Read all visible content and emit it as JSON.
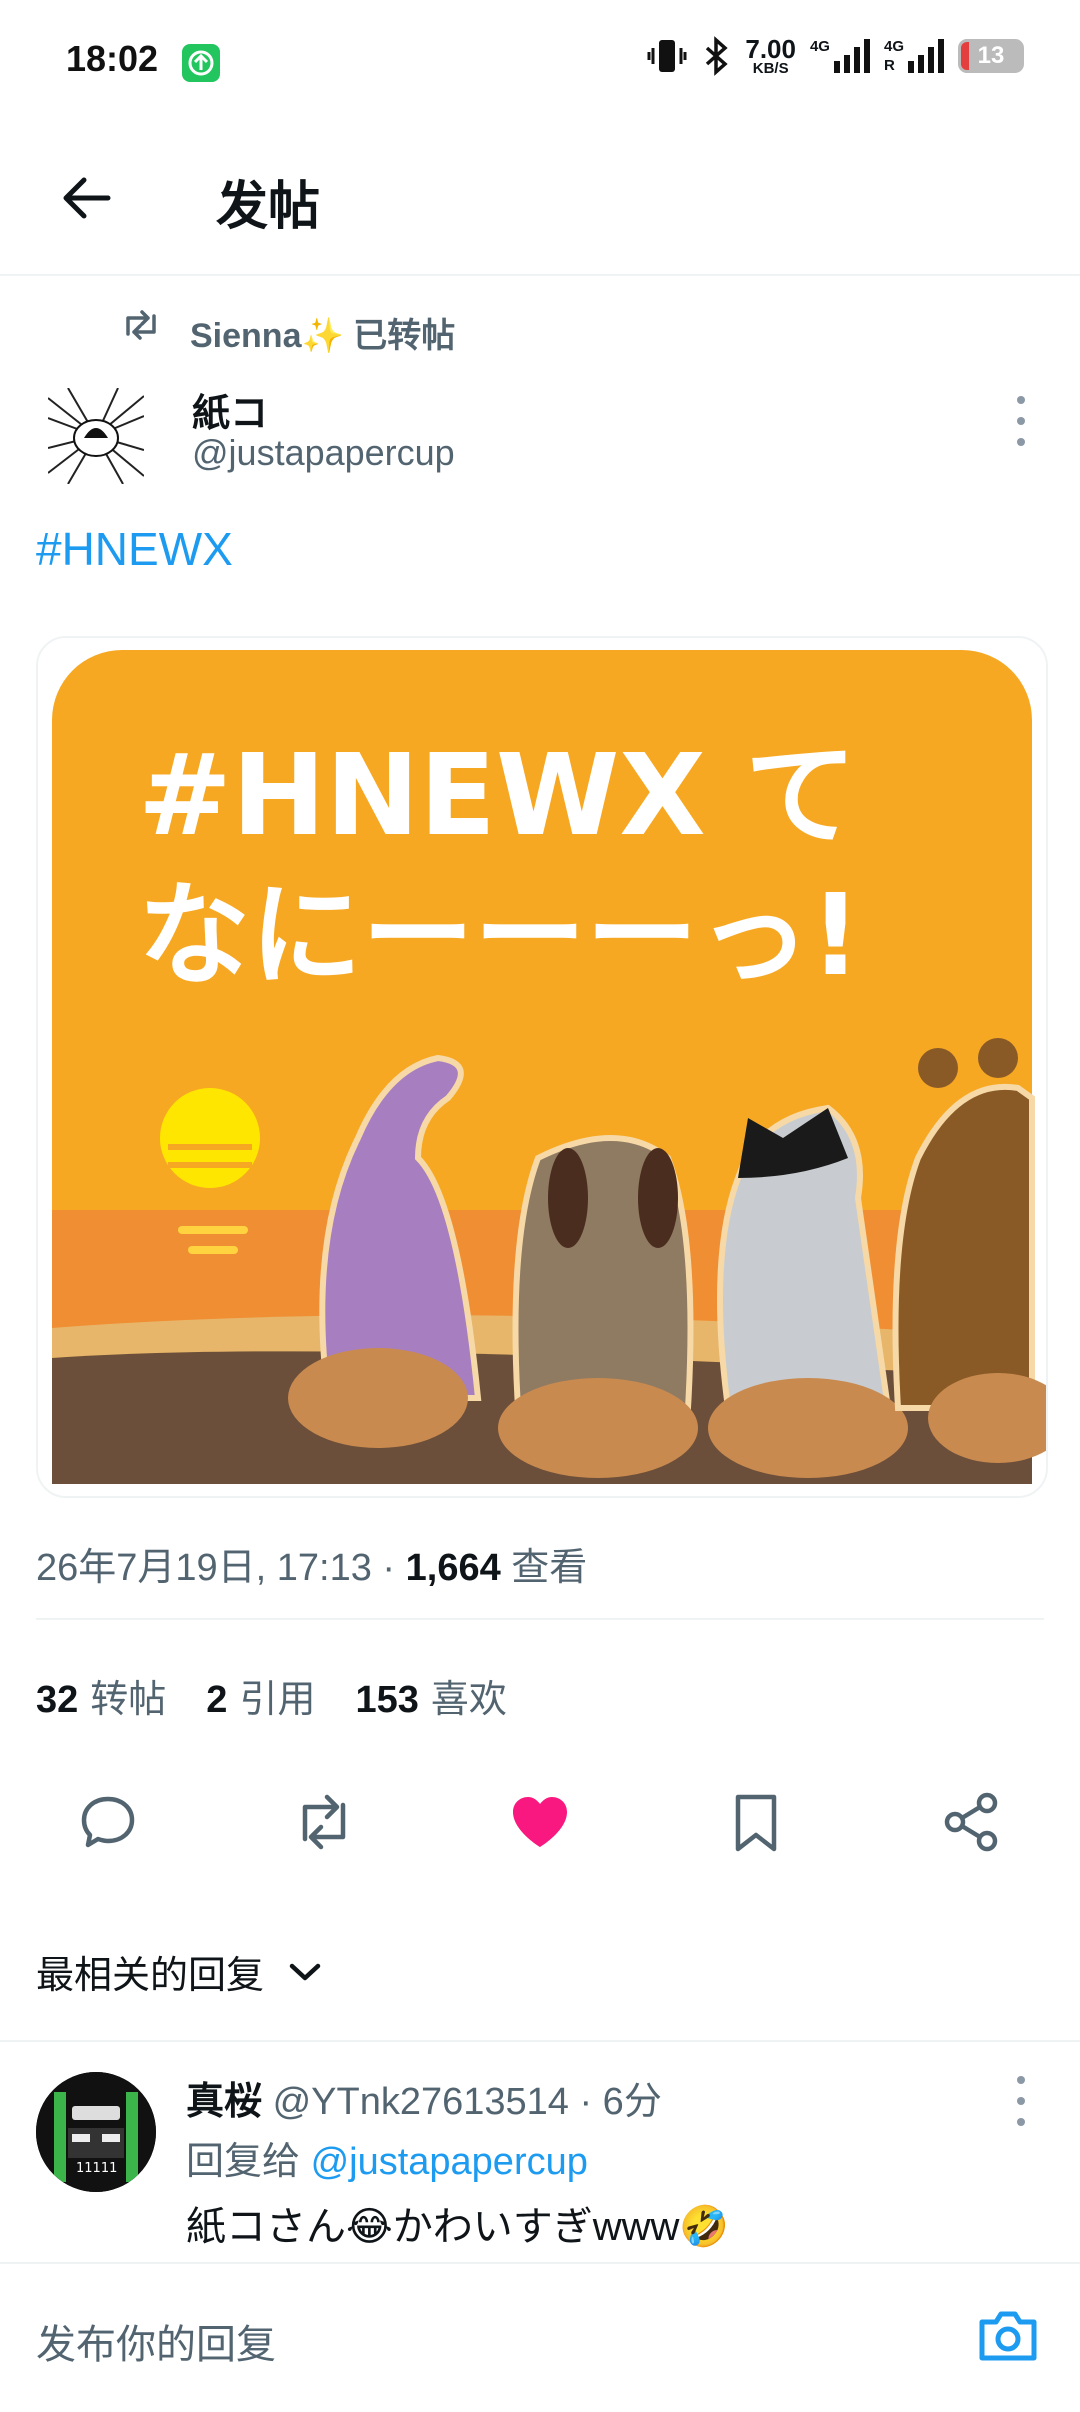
{
  "status_bar": {
    "time": "18:02",
    "speed_value": "7.00",
    "speed_unit": "KB/S",
    "net1": "4G",
    "net2": "4G",
    "net2_sub": "R",
    "battery_level": "13",
    "icons": [
      "app-update-icon",
      "vibrate-icon",
      "bluetooth-icon",
      "signal-icon",
      "battery-icon"
    ]
  },
  "header": {
    "title": "发帖",
    "back_icon": "arrow-left-icon"
  },
  "repost": {
    "text": "Sienna✨ 已转帖"
  },
  "post": {
    "author_name": "紙コ",
    "author_handle": "@justapapercup",
    "text": "#HNEWX",
    "image": {
      "line1": "#HNEWX て",
      "line2": "なにーーーっ!"
    },
    "meta_date": "26年7月19日, 17:13 · ",
    "views": "1,664",
    "views_label": " 查看"
  },
  "stats": {
    "reposts": "32",
    "reposts_label": "转帖",
    "quotes": "2",
    "quotes_label": "引用",
    "likes": "153",
    "likes_label": "喜欢"
  },
  "actions": {
    "icons": [
      "reply-icon",
      "repost-icon",
      "like-icon",
      "bookmark-icon",
      "share-icon"
    ],
    "like_color": "#f91880"
  },
  "replies": {
    "sort_label": "最相关的回复",
    "items": [
      {
        "name": "真桜",
        "handle": " @YTnk27613514 · 6分",
        "reply_to_label": "回复给 ",
        "reply_to_handle": "@justapapercup",
        "text": "紙コさん😂かわいすぎwww🤣"
      }
    ]
  },
  "compose": {
    "placeholder": "发布你的回复"
  },
  "colors": {
    "accent": "#1d9bf0",
    "text": "#0f1419",
    "secondary": "#536471"
  }
}
